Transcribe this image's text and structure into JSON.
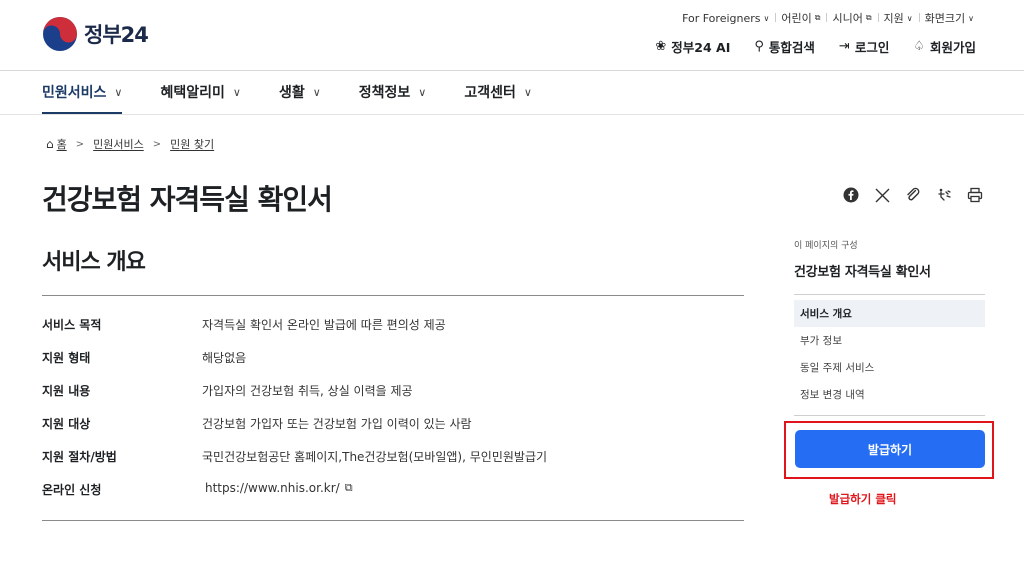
{
  "header": {
    "logo_text": "정부",
    "logo_num": "24",
    "utility": [
      {
        "label": "For Foreigners",
        "icon": "chevron-down-icon"
      },
      {
        "label": "어린이",
        "icon": "external-link-icon"
      },
      {
        "label": "시니어",
        "icon": "external-link-icon"
      },
      {
        "label": "지원",
        "icon": "chevron-down-icon"
      },
      {
        "label": "화면크기",
        "icon": "chevron-down-icon"
      }
    ],
    "main_links": [
      {
        "label": "정부24 AI",
        "icon": "ai-icon"
      },
      {
        "label": "통합검색",
        "icon": "search-icon"
      },
      {
        "label": "로그인",
        "icon": "login-icon"
      },
      {
        "label": "회원가입",
        "icon": "user-plus-icon"
      }
    ]
  },
  "gnb": [
    {
      "label": "민원서비스",
      "active": true
    },
    {
      "label": "혜택알리미"
    },
    {
      "label": "생활"
    },
    {
      "label": "정책정보"
    },
    {
      "label": "고객센터"
    }
  ],
  "breadcrumb": [
    "홈",
    "민원서비스",
    "민원 찾기"
  ],
  "page_title": "건강보험 자격득실 확인서",
  "share_tools": [
    "facebook-icon",
    "x-icon",
    "link-icon",
    "accessibility-icon",
    "print-icon"
  ],
  "overview": {
    "title": "서비스 개요",
    "rows": [
      {
        "key": "서비스 목적",
        "value": "자격득실 확인서 온라인 발급에 따른 편의성 제공"
      },
      {
        "key": "지원 형태",
        "value": "해당없음"
      },
      {
        "key": "지원 내용",
        "value": "가입자의 건강보험 취득, 상실 이력을 제공"
      },
      {
        "key": "지원 대상",
        "value": "건강보험 가입자 또는 건강보험 가입 이력이 있는 사람"
      },
      {
        "key": "지원 절차/방법",
        "value": "국민건강보험공단 홈페이지,The건강보험(모바일앱), 무인민원발급기"
      },
      {
        "key": "온라인 신청",
        "value": "https://www.nhis.or.kr/"
      }
    ]
  },
  "toc": {
    "caption": "이 페이지의 구성",
    "title": "건강보험 자격득실 확인서",
    "items": [
      "서비스 개요",
      "부가 정보",
      "동일 주제 서비스",
      "정보 변경 내역"
    ]
  },
  "issue_button": "발급하기",
  "hint_text": "발급하기 클릭",
  "colors": {
    "primary": "#256ef4",
    "highlight": "#e0151b",
    "navy": "#1b3a66"
  }
}
